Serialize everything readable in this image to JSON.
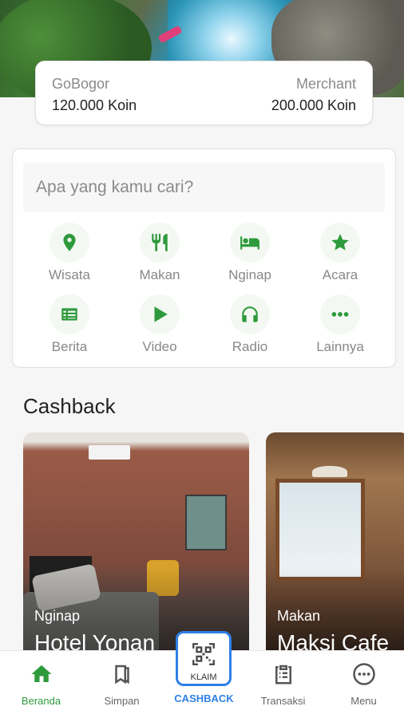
{
  "points": {
    "left_label": "GoBogor",
    "left_value": "120.000 Koin",
    "right_label": "Merchant",
    "right_value": "200.000 Koin"
  },
  "search": {
    "placeholder": "Apa yang kamu cari?"
  },
  "categories": [
    {
      "label": "Wisata",
      "icon": "location-pin-icon"
    },
    {
      "label": "Makan",
      "icon": "utensils-icon"
    },
    {
      "label": "Nginap",
      "icon": "bed-icon"
    },
    {
      "label": "Acara",
      "icon": "star-icon"
    },
    {
      "label": "Berita",
      "icon": "newspaper-icon"
    },
    {
      "label": "Video",
      "icon": "play-icon"
    },
    {
      "label": "Radio",
      "icon": "headphones-icon"
    },
    {
      "label": "Lainnya",
      "icon": "more-dots-icon"
    }
  ],
  "cashback": {
    "title": "Cashback",
    "items": [
      {
        "category": "Nginap",
        "name": "Hotel Yonan"
      },
      {
        "category": "Makan",
        "name": "Maksi Cafe"
      }
    ]
  },
  "nav": {
    "items": [
      {
        "label": "Beranda",
        "icon": "home-icon",
        "active": true
      },
      {
        "label": "Simpan",
        "icon": "bookmarks-icon"
      },
      {
        "label": "CASHBACK",
        "icon": "qr-code-icon"
      },
      {
        "label": "Transaksi",
        "icon": "clipboard-icon"
      },
      {
        "label": "Menu",
        "icon": "more-circle-icon"
      }
    ],
    "klaim_label": "KLAIM"
  },
  "colors": {
    "accent_green": "#2e9a3c",
    "accent_blue": "#2f7fe6"
  }
}
